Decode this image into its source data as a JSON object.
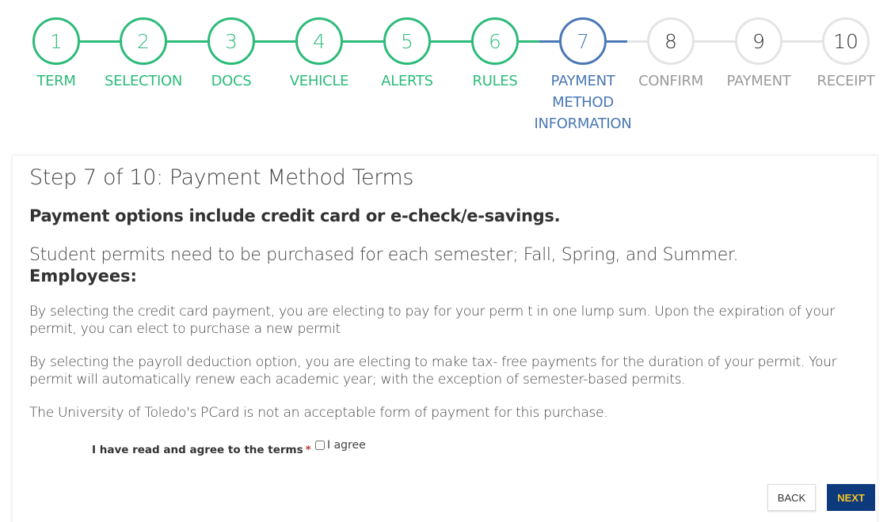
{
  "stepper": {
    "steps": [
      {
        "number": "1",
        "label": "TERM",
        "state": "complete"
      },
      {
        "number": "2",
        "label": "SELECTION",
        "state": "complete"
      },
      {
        "number": "3",
        "label": "DOCS",
        "state": "complete"
      },
      {
        "number": "4",
        "label": "VEHICLE",
        "state": "complete"
      },
      {
        "number": "5",
        "label": "ALERTS",
        "state": "complete"
      },
      {
        "number": "6",
        "label": "RULES",
        "state": "complete"
      },
      {
        "number": "7",
        "label": "PAYMENT METHOD INFORMATION",
        "label_lines": [
          "PAYMENT",
          "METHOD",
          "INFORMATION"
        ],
        "state": "current"
      },
      {
        "number": "8",
        "label": "CONFIRM",
        "state": "future"
      },
      {
        "number": "9",
        "label": "PAYMENT",
        "state": "future"
      },
      {
        "number": "10",
        "label": "RECEIPT",
        "state": "future"
      }
    ],
    "colors": {
      "complete": "#2dbb7a",
      "current": "#4a78b5",
      "future": "#e4e4e4"
    }
  },
  "content": {
    "title": "Step 7 of 10: Payment Method Terms",
    "subtitle": "Payment options include credit card or e-check/e-savings.",
    "students_note": "Student permits need to be purchased for each semester; Fall, Spring, and Summer.",
    "employees_heading": "Employees:",
    "paragraphs": [
      "By selecting the credit card payment, you are electing to pay for your perm t in one lump sum.  Upon the expiration of your permit, you can elect to purchase a new permit",
      "By selecting the payroll deduction option, you are electing to make tax- free payments for the duration of your permit. Your permit will automatically renew each academic year; with the exception of semester-based permits.",
      "The University of Toledo's PCard is not an acceptable form of payment for this purchase."
    ]
  },
  "agreement": {
    "label": "I have read and agree to the terms",
    "required_mark": "*",
    "checkbox_label": "I agree",
    "checked": false
  },
  "buttons": {
    "back": "BACK",
    "next": "NEXT"
  }
}
